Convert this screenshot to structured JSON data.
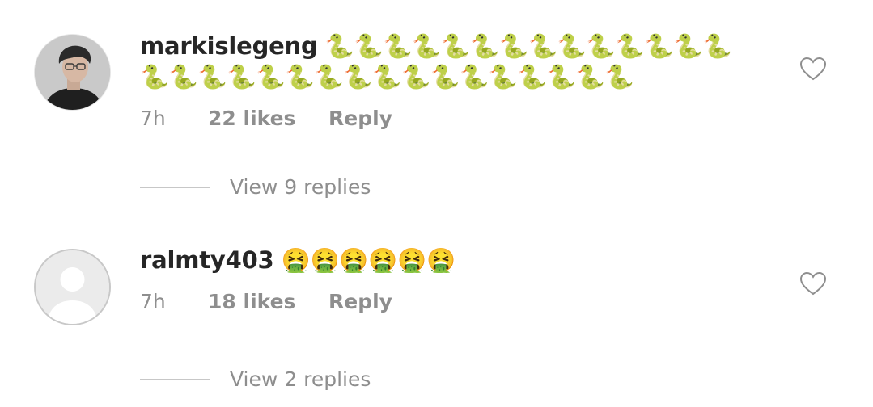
{
  "comments": [
    {
      "username": "markislegeng",
      "text": "🐍🐍🐍🐍🐍🐍🐍🐍🐍🐍🐍🐍🐍🐍🐍🐍🐍🐍🐍🐍🐍🐍🐍🐍🐍🐍🐍🐍🐍🐍🐍",
      "time": "7h",
      "likes": "22 likes",
      "reply_label": "Reply",
      "view_replies": "View 9 replies",
      "avatar_icon": "profile-photo",
      "like_icon": "heart-outline-icon"
    },
    {
      "username": "ralmty403",
      "text": "🤮🤮🤮🤮🤮🤮",
      "time": "7h",
      "likes": "18 likes",
      "reply_label": "Reply",
      "view_replies": "View 2 replies",
      "avatar_icon": "default-avatar-icon",
      "like_icon": "heart-outline-icon"
    }
  ],
  "colors": {
    "primary_text": "#262626",
    "secondary_text": "#8e8e8e",
    "divider": "#c7c7c7"
  }
}
